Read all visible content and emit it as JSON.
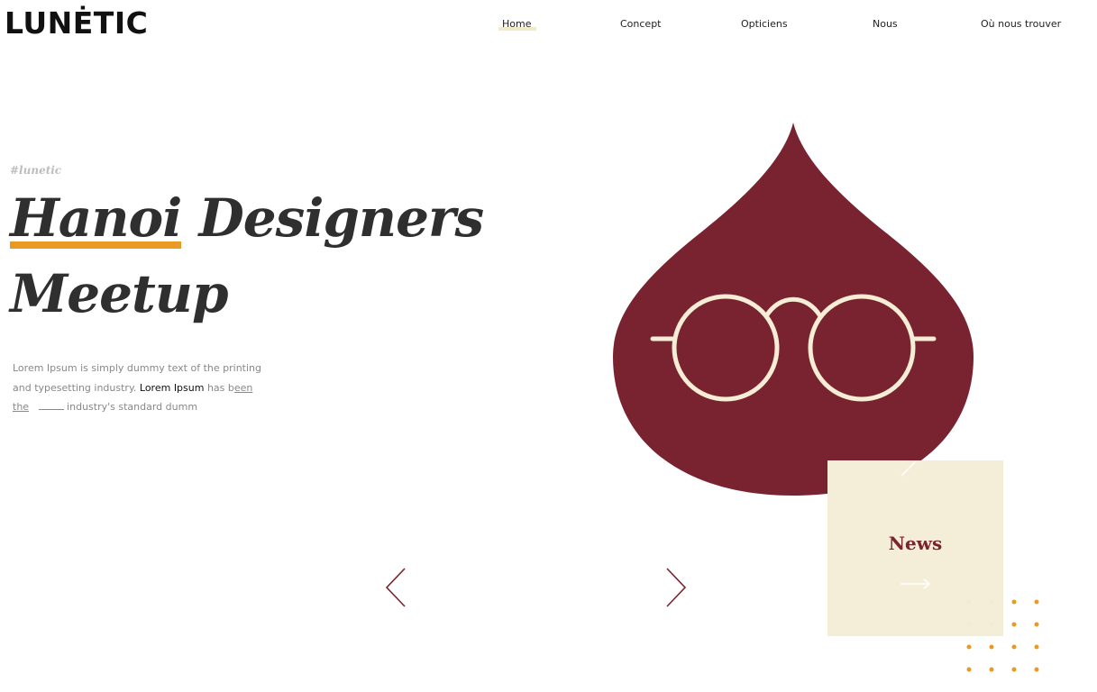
{
  "brand": {
    "logo_text": "LUNĖTIC"
  },
  "nav": {
    "items": [
      {
        "label": "Home",
        "active": true
      },
      {
        "label": "Concept"
      },
      {
        "label": "Opticiens"
      },
      {
        "label": "Nous"
      },
      {
        "label": "Où nous trouver"
      }
    ]
  },
  "hero": {
    "hashtag": "#lunetic",
    "title_highlight": "Hanoi",
    "title_rest": " Designers Meetup",
    "desc_part1": "Lorem Ipsum is simply dummy text of the printing and typesetting industry. ",
    "desc_bold": "Lorem Ipsum",
    "desc_part2": " has b",
    "desc_link": "een the",
    "desc_part3": " industry's standard dumm"
  },
  "news": {
    "label": "News"
  },
  "colors": {
    "maroon": "#7a2330",
    "cream": "#f4eed8",
    "orange": "#e99a23",
    "text_dark": "#2f2f2f"
  },
  "icons": {
    "prev": "chevron-left-icon",
    "next": "chevron-right-icon",
    "glasses": "glasses-icon",
    "news_arrow": "arrow-right-icon"
  }
}
